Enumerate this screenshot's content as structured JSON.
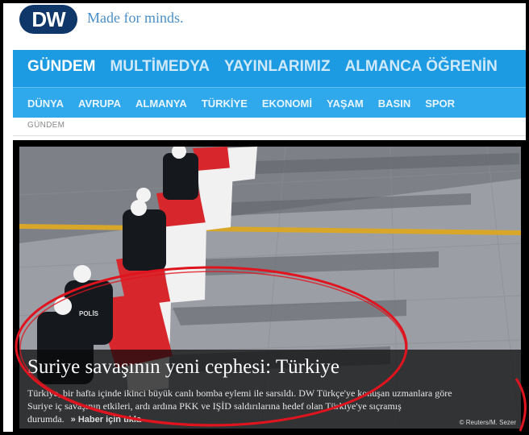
{
  "brand": {
    "logo": "DW",
    "tagline": "Made for minds."
  },
  "main_nav": [
    {
      "label": "GÜNDEM",
      "active": true
    },
    {
      "label": "MULTİMEDYA",
      "active": false
    },
    {
      "label": "YAYINLARIMIZ",
      "active": false
    },
    {
      "label": "ALMANCA ÖĞRENİN",
      "active": false
    }
  ],
  "sub_nav": [
    "DÜNYA",
    "AVRUPA",
    "ALMANYA",
    "TÜRKİYE",
    "EKONOMİ",
    "YAŞAM",
    "BASIN",
    "SPOR"
  ],
  "breadcrumb": "GÜNDEM",
  "hero": {
    "headline": "Suriye savaşının yeni cephesi: Türkiye",
    "summary": "Türkiye, bir hafta içinde ikinci büyük canlı bomba eylemi ile sarsıldı. DW Türkçe'ye konuşan uzmanlara göre Suriye iç savaşının etkileri, ardı ardına PKK ve IŞİD saldırılarına hedef olan Türkiye'ye sıçramış durumda.",
    "more_link": "» Haber için tıkla",
    "credit": "© Reuters/M. Sezer",
    "badge_text": "POLİS"
  },
  "colors": {
    "nav_bg": "#1c9ae2",
    "subnav_bg": "#2fa8ec",
    "logo_bg": "#0f3769",
    "tagline": "#4a8fc8",
    "annotation": "#e0141e"
  },
  "icons": {
    "more_link": "double-chevron-right-icon"
  }
}
